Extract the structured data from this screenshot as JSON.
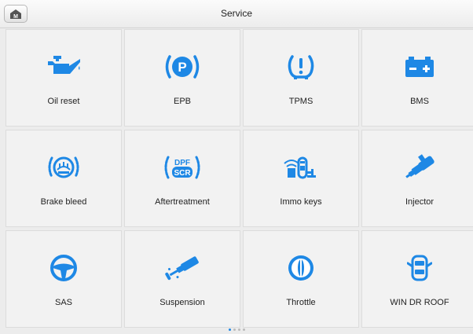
{
  "header": {
    "title": "Service",
    "home_icon": "home-icon",
    "home_glyph": "M"
  },
  "tiles": [
    {
      "label": "Oil reset",
      "icon": "oil-can-icon"
    },
    {
      "label": "EPB",
      "icon": "parking-brake-icon"
    },
    {
      "label": "TPMS",
      "icon": "tire-pressure-icon"
    },
    {
      "label": "BMS",
      "icon": "battery-icon"
    },
    {
      "label": "Brake bleed",
      "icon": "brake-bleed-icon"
    },
    {
      "label": "Aftertreatment",
      "icon": "dpf-scr-icon",
      "icon_text_top": "DPF",
      "icon_text_bottom": "SCR"
    },
    {
      "label": "Immo keys",
      "icon": "immo-key-icon"
    },
    {
      "label": "Injector",
      "icon": "injector-icon"
    },
    {
      "label": "SAS",
      "icon": "steering-wheel-icon"
    },
    {
      "label": "Suspension",
      "icon": "suspension-icon"
    },
    {
      "label": "Throttle",
      "icon": "throttle-icon"
    },
    {
      "label": "WIN DR ROOF",
      "icon": "car-door-window-icon"
    }
  ],
  "pager": {
    "pages": 4,
    "current": 1
  },
  "colors": {
    "accent": "#1e88e5",
    "tile_bg": "#f2f2f2",
    "header_bg": "#f4f4f4"
  }
}
